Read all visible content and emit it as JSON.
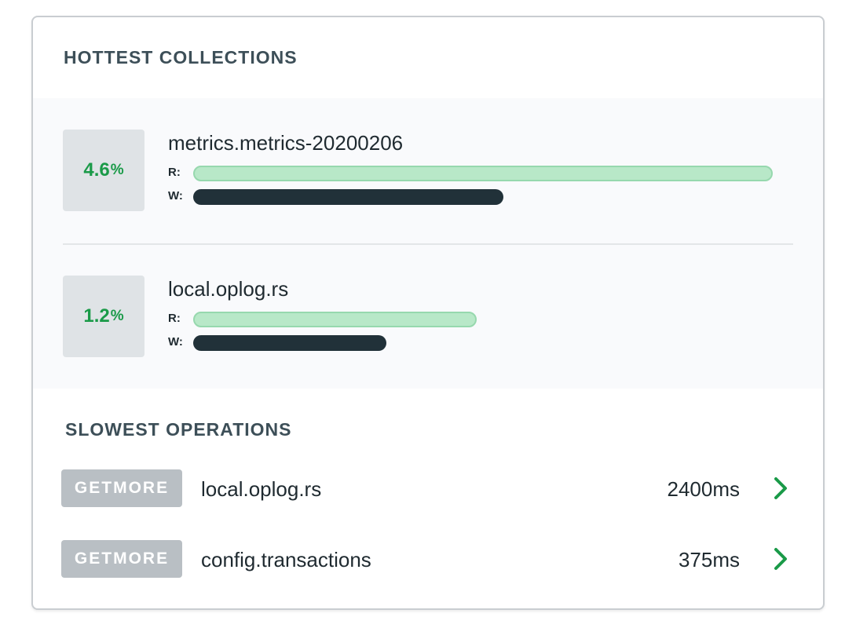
{
  "hottest": {
    "title": "HOTTEST COLLECTIONS",
    "items": [
      {
        "percent": "4.6",
        "percent_sign": "%",
        "name": "metrics.metrics-20200206",
        "read_label": "R:",
        "write_label": "W:",
        "read_fraction": 1.0,
        "write_fraction": 0.535
      },
      {
        "percent": "1.2",
        "percent_sign": "%",
        "name": "local.oplog.rs",
        "read_label": "R:",
        "write_label": "W:",
        "read_fraction": 0.489,
        "write_fraction": 0.333
      }
    ]
  },
  "slowest": {
    "title": "SLOWEST OPERATIONS",
    "operations": [
      {
        "type": "GETMORE",
        "collection": "local.oplog.rs",
        "duration": "2400ms",
        "icon": "chevron-right-icon"
      },
      {
        "type": "GETMORE",
        "collection": "config.transactions",
        "duration": "375ms",
        "icon": "chevron-right-icon"
      }
    ]
  },
  "colors": {
    "accent_green": "#1a9a48",
    "read_bar": "#b8e8c8",
    "write_bar": "#213139",
    "badge_gray": "#b9bfc4"
  }
}
